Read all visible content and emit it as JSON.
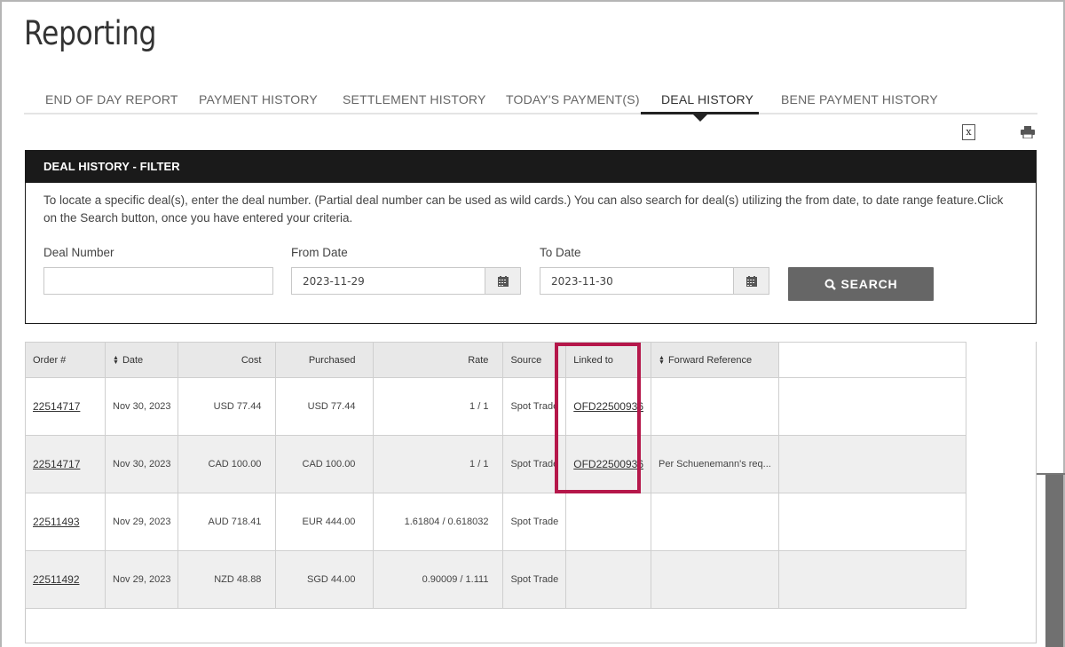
{
  "page": {
    "title": "Reporting"
  },
  "tabs": [
    {
      "label": "END OF DAY REPORT",
      "active": false
    },
    {
      "label": "PAYMENT HISTORY",
      "active": false
    },
    {
      "label": "SETTLEMENT HISTORY",
      "active": false
    },
    {
      "label": "TODAY'S PAYMENT(S)",
      "active": false
    },
    {
      "label": "DEAL HISTORY",
      "active": true
    },
    {
      "label": "BENE PAYMENT HISTORY",
      "active": false
    }
  ],
  "toolbar": {
    "excel_icon": "excel-export-icon",
    "excel_glyph": "x",
    "print_icon": "print-icon"
  },
  "filter": {
    "title": "DEAL HISTORY - FILTER",
    "description": "To locate a specific deal(s), enter the deal number. (Partial deal number can be used as wild cards.) You can also search for deal(s) utilizing the from date, to date range feature.Click on the Search button, once you have entered your criteria.",
    "deal_number": {
      "label": "Deal Number",
      "value": ""
    },
    "from_date": {
      "label": "From Date",
      "value": "2023-11-29"
    },
    "to_date": {
      "label": "To Date",
      "value": "2023-11-30"
    },
    "search_label": "SEARCH"
  },
  "table": {
    "headers": {
      "order": "Order #",
      "date": "Date",
      "cost": "Cost",
      "purchased": "Purchased",
      "rate": "Rate",
      "source": "Source",
      "linked": "Linked to",
      "forward": "Forward Reference"
    },
    "rows": [
      {
        "order": "22514717",
        "date": "Nov 30, 2023",
        "cost": "USD 77.44",
        "purchased": "USD 77.44",
        "rate": "1 / 1",
        "source": "Spot Trade",
        "linked": "OFD22500936",
        "forward": ""
      },
      {
        "order": "22514717",
        "date": "Nov 30, 2023",
        "cost": "CAD 100.00",
        "purchased": "CAD 100.00",
        "rate": "1 / 1",
        "source": "Spot Trade",
        "linked": "OFD22500936",
        "forward": "Per Schuenemann's req..."
      },
      {
        "order": "22511493",
        "date": "Nov 29, 2023",
        "cost": "AUD 718.41",
        "purchased": "EUR 444.00",
        "rate": "1.61804 / 0.618032",
        "source": "Spot Trade",
        "linked": "",
        "forward": ""
      },
      {
        "order": "22511492",
        "date": "Nov 29, 2023",
        "cost": "NZD 48.88",
        "purchased": "SGD 44.00",
        "rate": "0.90009 / 1.111",
        "source": "Spot Trade",
        "linked": "",
        "forward": ""
      }
    ]
  },
  "colors": {
    "highlight": "#b5174a",
    "header_bar": "#1a1a1a",
    "search_button": "#666666"
  }
}
